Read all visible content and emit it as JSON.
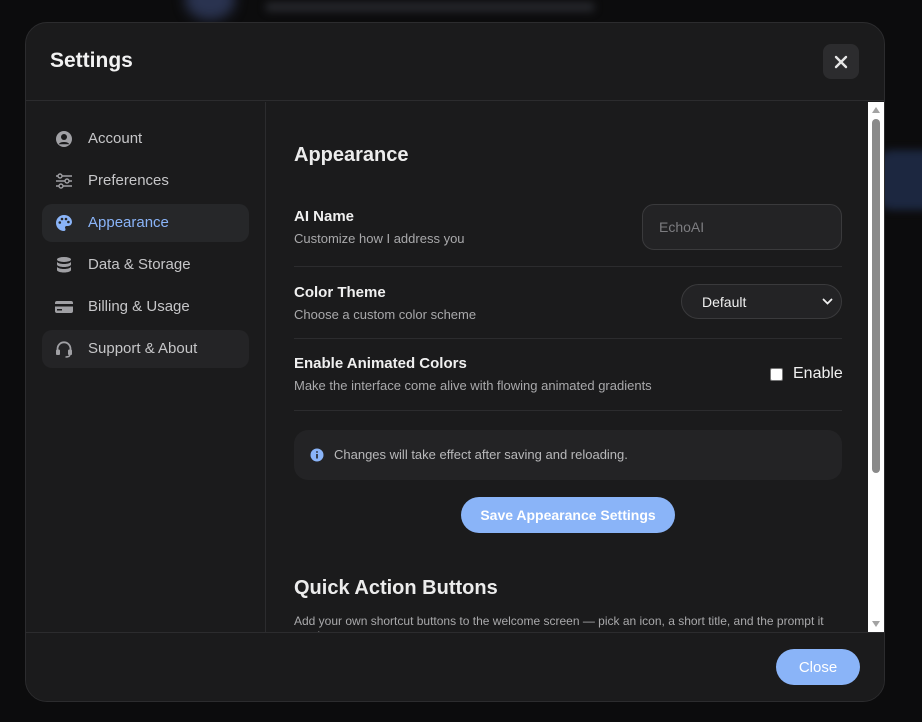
{
  "header": {
    "title": "Settings",
    "close_icon": "close-icon"
  },
  "sidebar": {
    "items": [
      {
        "label": "Account",
        "icon": "account-circle-icon"
      },
      {
        "label": "Preferences",
        "icon": "sliders-icon"
      },
      {
        "label": "Appearance",
        "icon": "palette-icon",
        "active": true
      },
      {
        "label": "Data & Storage",
        "icon": "database-icon"
      },
      {
        "label": "Billing & Usage",
        "icon": "credit-card-icon"
      },
      {
        "label": "Support & About",
        "icon": "headset-icon"
      }
    ]
  },
  "appearance": {
    "title": "Appearance",
    "ai_name": {
      "label": "AI Name",
      "description": "Customize how I address you",
      "placeholder": "EchoAI",
      "value": ""
    },
    "color_theme": {
      "label": "Color Theme",
      "description": "Choose a custom color scheme",
      "selected": "Default"
    },
    "animated_colors": {
      "label": "Enable Animated Colors",
      "description": "Make the interface come alive with flowing animated gradients",
      "checkbox_label": "Enable",
      "checked": false
    },
    "info": "Changes will take effect after saving and reloading.",
    "save_label": "Save Appearance Settings"
  },
  "quick_actions": {
    "title": "Quick Action Buttons",
    "description": "Add your own shortcut buttons to the welcome screen — pick an icon, a short title, and the prompt it sends."
  },
  "footer": {
    "close_label": "Close"
  },
  "colors": {
    "accent": "#8ab4f8",
    "background": "#1b1b1c",
    "border": "#2c2c2e"
  }
}
